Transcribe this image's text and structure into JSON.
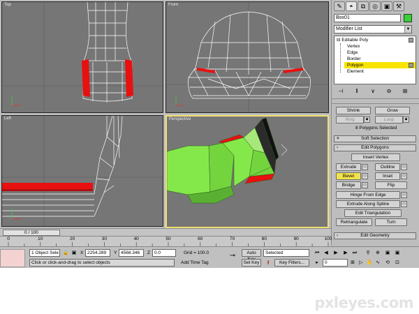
{
  "viewports": {
    "top": {
      "label": "Top"
    },
    "front": {
      "label": "Front"
    },
    "left": {
      "label": "Left"
    },
    "perspective": {
      "label": "Perspective"
    }
  },
  "panel": {
    "tab_icons": [
      "create-icon",
      "modify-icon",
      "hierarchy-icon",
      "motion-icon",
      "display-icon",
      "utilities-icon"
    ],
    "object_name": "Box01",
    "object_color": "#35d235",
    "modifier_list": "Modifier List",
    "stack": {
      "root": "Editable Poly",
      "levels": [
        "Vertex",
        "Edge",
        "Border",
        "Polygon",
        "Element"
      ],
      "selected": "Polygon"
    },
    "selection": {
      "shrink": "Shrink",
      "grow": "Grow",
      "ring": "Ring",
      "loop": "Loop",
      "status": "8 Polygons Selected"
    },
    "soft_selection": {
      "sign": "+",
      "title": "Soft Selection"
    },
    "edit_polygons": {
      "sign": "-",
      "title": "Edit Polygons",
      "insert_vertex": "Insert Vertex",
      "extrude": "Extrude",
      "outline": "Outline",
      "bevel": "Bevel",
      "inset": "Inset",
      "bridge": "Bridge",
      "flip": "Flip",
      "hinge": "Hinge From Edge",
      "extrude_spline": "Extrude Along Spline",
      "edit_triangulation": "Edit Triangulation",
      "retriangulate": "Retriangulate",
      "turn": "Turn"
    },
    "edit_geometry": {
      "sign": "-",
      "title": "Edit Geometry"
    }
  },
  "timeline": {
    "slider": "0 / 100",
    "ticks": [
      "0",
      "10",
      "20",
      "30",
      "40",
      "50",
      "60",
      "70",
      "80",
      "90",
      "100"
    ]
  },
  "status": {
    "selection": "1 Object Sele",
    "x_label": "X",
    "x_value": "2254.289",
    "y_label": "Y",
    "y_value": "4568.346",
    "z_label": "Z",
    "z_value": "0.0",
    "grid": "Grid = 100.0",
    "prompt": "Click or click-and-drag to select objects",
    "add_time_tag": "Add Time Tag",
    "auto_key": "Auto Key",
    "set_key": "Set Key",
    "key_mode": "Selected",
    "key_filters": "Key Filters...",
    "frame": "0"
  },
  "colors": {
    "viewport_bg": "#767676",
    "active_border": "#f0e070",
    "selected_poly": "#e81010",
    "mesh_green": "#84e84a",
    "highlight": "#f8e400"
  },
  "watermark": "pxleyes.com"
}
